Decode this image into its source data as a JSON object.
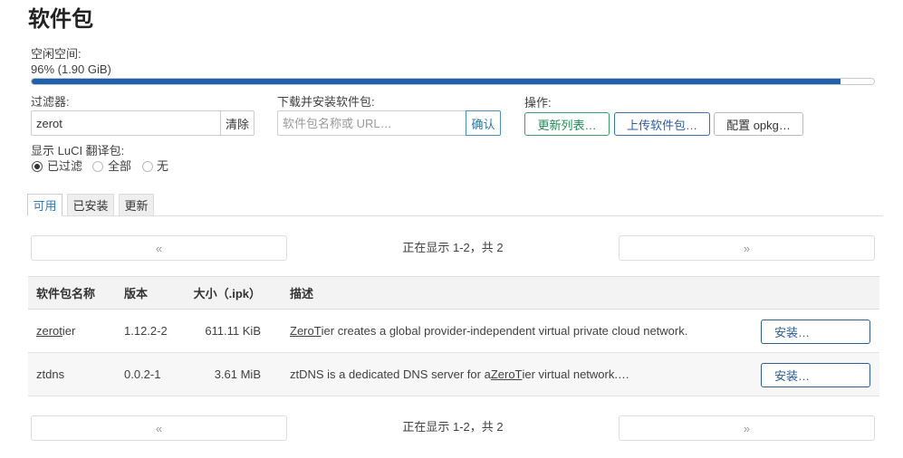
{
  "page_title": "软件包",
  "free_space": {
    "label": "空闲空间:",
    "value": "96% (1.90 GiB)",
    "percent": 96
  },
  "filter": {
    "label": "过滤器:",
    "value": "zerot",
    "clear_label": "清除"
  },
  "download": {
    "label": "下载并安装软件包:",
    "placeholder": "软件包名称或 URL…",
    "confirm_label": "确认"
  },
  "actions": {
    "label": "操作:",
    "update_label": "更新列表…",
    "upload_label": "上传软件包…",
    "config_label": "配置 opkg…"
  },
  "translations": {
    "label": "显示 LuCI 翻译包:",
    "options": [
      {
        "label": "已过滤",
        "checked": true
      },
      {
        "label": "全部",
        "checked": false
      },
      {
        "label": "无",
        "checked": false
      }
    ]
  },
  "tabs": [
    {
      "label": "可用",
      "active": true
    },
    {
      "label": "已安装",
      "active": false
    },
    {
      "label": "更新",
      "active": false
    }
  ],
  "pager": {
    "prev": "«",
    "next": "»",
    "status": "正在显示 1-2，共 2"
  },
  "table": {
    "headers": {
      "name": "软件包名称",
      "version": "版本",
      "size": "大小（.ipk）",
      "description": "描述"
    },
    "rows": [
      {
        "name_match": "zerot",
        "name_rest": "ier",
        "version": "1.12.2-2",
        "size": "611.11 KiB",
        "desc_before": "",
        "desc_match": "ZeroT",
        "desc_after": "ier creates a global provider-independent virtual private cloud network.",
        "action": "安装…"
      },
      {
        "name_match": "",
        "name_rest": "ztdns",
        "version": "0.0.2-1",
        "size": "3.61 MiB",
        "desc_before": "ztDNS is a dedicated DNS server for a ",
        "desc_match": "ZeroT",
        "desc_after": "ier virtual network.…",
        "action": "安装…"
      }
    ]
  },
  "colors": {
    "bar_fill": "#1f5fb0",
    "active_tab": "#2f7ab7",
    "update_button": "#1e8a55",
    "upload_button": "#2a5ea6",
    "install_button": "#2b5c92"
  }
}
